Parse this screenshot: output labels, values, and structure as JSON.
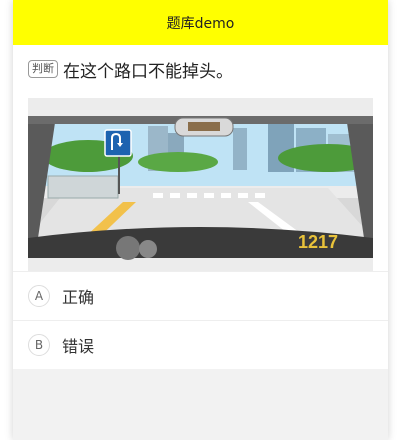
{
  "navbar": {
    "title": "题库demo"
  },
  "question": {
    "type_tag": "判断",
    "text": "在这个路口不能掉头。",
    "image": {
      "description_icon": "road-scene-illustration",
      "sign_icon": "u-turn-sign-icon",
      "watermark": "1217"
    }
  },
  "options": [
    {
      "letter": "A",
      "label": "正确"
    },
    {
      "letter": "B",
      "label": "错误"
    }
  ],
  "colors": {
    "navbar_bg": "#ffff00",
    "page_bg": "#f2f2f2"
  }
}
